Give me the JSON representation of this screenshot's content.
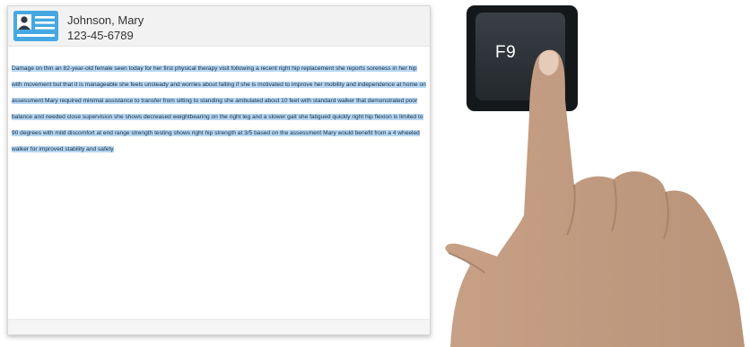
{
  "patient": {
    "name": "Johnson, Mary",
    "id": "123-45-6789",
    "card_icon": "patient-id-card-icon"
  },
  "note": {
    "text": "Damage on thin an 82-year-old female seen today for her first physical therapy visit following a recent right hip replacement she reports soreness in her hip with movement but that it is manageable she feels unsteady and worries about falling if she is motivated to improve her mobility and independence at home on assessment Mary required minimal assistance to transfer from sitting to standing she ambulated about 10 feet with standard walker that demonstrated poor balance and needed close supervision she shows decreased weightbearing on the right leg and a slower gait she fatigued quickly right hip flexion is limited to 90 degrees with mild discomfort at end range strength testing shows right hip strength at 3/5 based on the assessment Mary would benefit from a 4 wheeled walker for improved stability and safety",
    "selected": true
  },
  "keyboard": {
    "key_label": "F9"
  },
  "colors": {
    "selection": "#b6d7f5",
    "card_blue": "#46a8e2",
    "key_dark": "#1e2226",
    "skin": "#c9a489"
  }
}
